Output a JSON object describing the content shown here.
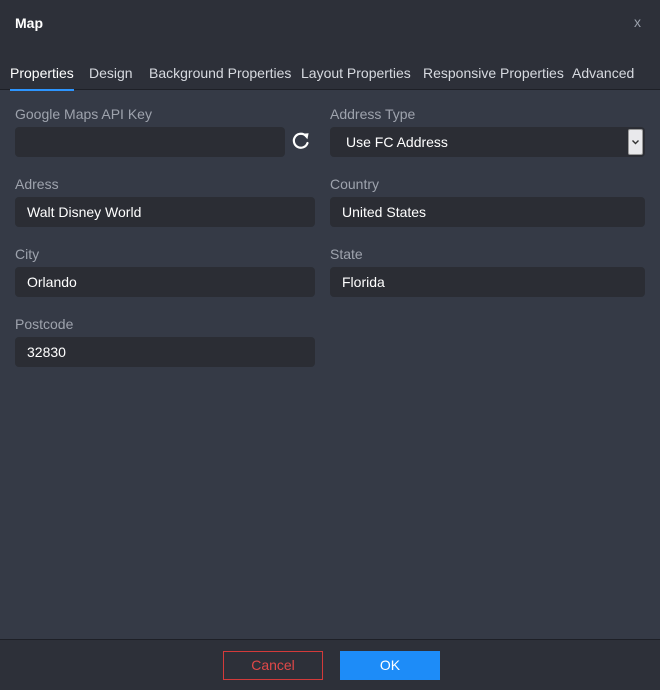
{
  "dialog": {
    "title": "Map",
    "close_label": "x"
  },
  "tabs": [
    {
      "label": "Properties"
    },
    {
      "label": "Design"
    },
    {
      "label": "Background Properties"
    },
    {
      "label": "Layout Properties"
    },
    {
      "label": "Responsive Properties"
    },
    {
      "label": "Advanced"
    }
  ],
  "fields": {
    "api_key": {
      "label": "Google Maps API Key",
      "value": ""
    },
    "address_type": {
      "label": "Address Type",
      "value": "Use FC Address"
    },
    "address": {
      "label": "Adress",
      "value": "Walt Disney World"
    },
    "country": {
      "label": "Country",
      "value": "United States"
    },
    "city": {
      "label": "City",
      "value": "Orlando"
    },
    "state": {
      "label": "State",
      "value": "Florida"
    },
    "postcode": {
      "label": "Postcode",
      "value": "32830"
    }
  },
  "icons": {
    "refresh": "refresh-icon",
    "dropdown": "chevron-down-icon"
  },
  "footer": {
    "cancel_label": "Cancel",
    "ok_label": "OK"
  },
  "colors": {
    "accent": "#1d8cf8",
    "danger": "#e04848",
    "background": "#353a46"
  }
}
